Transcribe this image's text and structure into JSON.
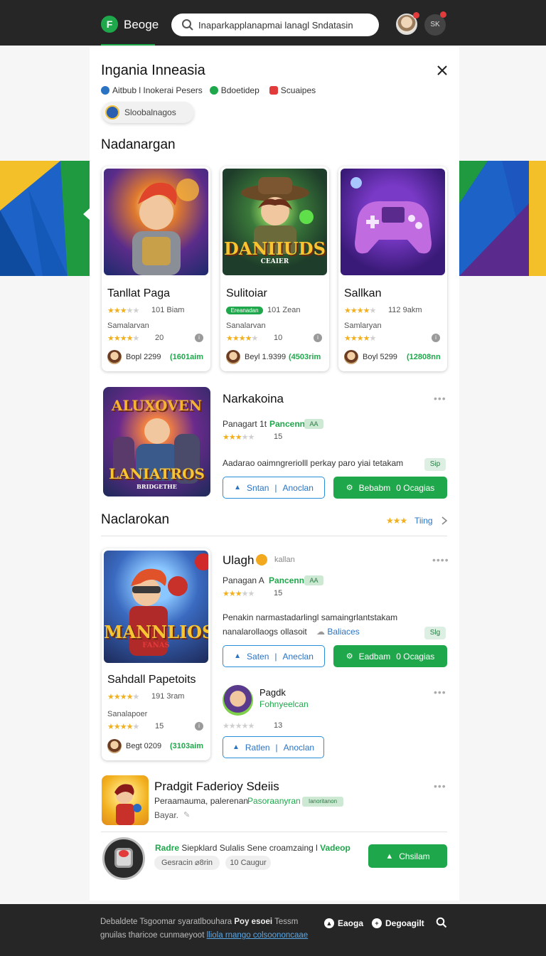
{
  "header": {
    "logo_letter": "F",
    "brand": "Beoge",
    "search_value": "Inaparkapplanapmai lanagl Sndatasin",
    "user_initials": "SK"
  },
  "page": {
    "title": "Ingania Inneasia",
    "meta": [
      {
        "label": "Aitbub l Inokerai Pesers",
        "color": "#2a73c2"
      },
      {
        "label": "Bdoetidep",
        "color": "#1fa84b"
      },
      {
        "label": "Scuaipes",
        "color": "#e23b3b"
      }
    ],
    "pill_label": "Sloobalnagos"
  },
  "sections": {
    "first": "Nadanargan",
    "second": "Naclarokan",
    "second_link": "Tiing",
    "second_stars": "★★★"
  },
  "cards": [
    {
      "image_text": "",
      "title": "Tanllat Paga",
      "rating_text": "101 Biam",
      "sub_label": "Samalarvan",
      "count": "20",
      "price": "Bopl 2299",
      "green_text": "(1601aim",
      "tag": ""
    },
    {
      "image_text": "DANIIUDS",
      "image_sub": "CEAIER",
      "title": "Sulitoiar",
      "rating_text": "101 Zean",
      "sub_label": "Sanalarvan",
      "count": "10",
      "price": "Beyl 1.9399",
      "green_text": "(4503rim",
      "tag": "Ereanadan"
    },
    {
      "image_text": "",
      "title": "Sallkan",
      "rating_text": "112 9akm",
      "sub_label": "Samlaryan",
      "count": "",
      "price": "Boyl 5299",
      "green_text": "(12808nn",
      "tag": ""
    }
  ],
  "featured": {
    "image_top": "ALUXOVEN",
    "image_bottom": "LANIATROS",
    "image_caption": "BRIDGETHE",
    "title": "Narkakoina",
    "meta": "Panagart 1t",
    "meta_green": "Pancenn",
    "chip": "AA",
    "count": "15",
    "desc": "Aadarao oaimngreriolll perkay paro yiai tetakam",
    "side_chip": "Sip",
    "btn_outline_a": "Sntan",
    "btn_outline_b": "Anoclan",
    "btn_fill_a": "Bebabm",
    "btn_fill_b": "0 Ocagias"
  },
  "second_card": {
    "image_text": "MANNLIOS",
    "image_sub": "FANAS",
    "title": "Sahdall Papetoits",
    "rating_text": "191 3ram",
    "sub_label": "Sanalapoer",
    "count": "15",
    "price": "Begt 0209",
    "green_text": "(3103aim"
  },
  "entry_ulagh": {
    "title": "Ulagh",
    "badge": "kallan",
    "meta": "Panagan A",
    "meta_green": "Pancenn",
    "chip": "AA",
    "count": "15",
    "desc_line1": "Penakin narmastadarlingl samaingrlantstakam",
    "desc_line2": "nanalarollaogs ollasoit",
    "desc_link": "Baliaces",
    "side_chip": "Slg",
    "btn_outline_a": "Saten",
    "btn_outline_b": "Aneclan",
    "btn_fill_a": "Eadbam",
    "btn_fill_b": "0 Ocagias"
  },
  "entry_pagdk": {
    "title": "Pagdk",
    "subtitle": "Fohnyeelcan",
    "count": "13",
    "btn_a": "Ratlen",
    "btn_b": "Anoclan"
  },
  "entry_pradgit": {
    "title": "Pradgit Faderioy Sdeiis",
    "meta": "Peraamauma, palerenan",
    "meta_green": "Pasoraanyran",
    "chip": "Ianoritanon",
    "sub": "Bayar."
  },
  "entry_radre": {
    "title_green": "Radre",
    "title_rest": "Siepklard Sulalis Sene croamzaing l",
    "title_tail": "Vadeop",
    "chip_a": "Gesracin ⌀8rin",
    "chip_b": "10 Caugur",
    "button": "Chsilam"
  },
  "footer": {
    "line1": "Debaldete Tsgoomar syaratlbouhara",
    "line1_bold": "Poy esoei",
    "line1_tail": "Tessm",
    "line2": "gnuilas tharicoe cunmaeyoot",
    "line2_link": "lliola rnango colsoononcaae",
    "btn_a": "Eaoga",
    "btn_b": "Degoagilt"
  },
  "colors": {
    "accent": "#1fa84b",
    "topbar": "#262626",
    "link": "#2a73c2",
    "star": "#f2b01e"
  }
}
